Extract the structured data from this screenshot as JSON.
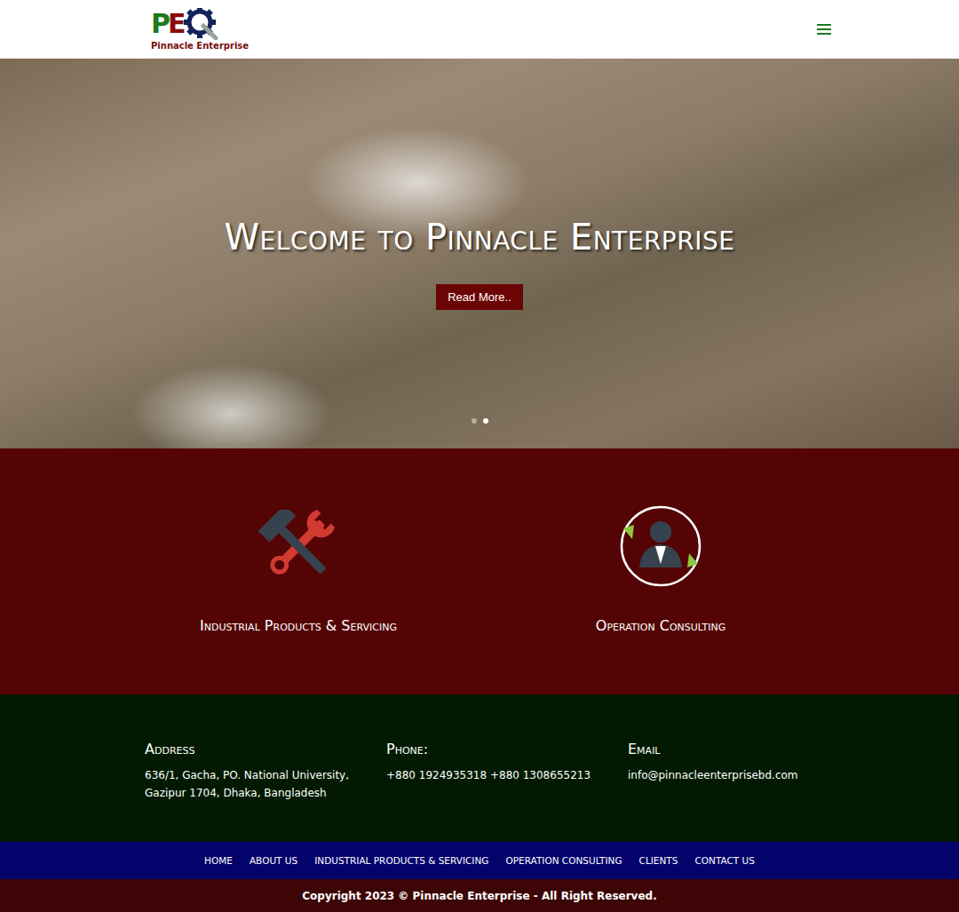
{
  "header": {
    "logo_mark": "PE",
    "logo_text": "Pinnacle Enterprise"
  },
  "hero": {
    "title": "Welcome to Pinnacle Enterprise",
    "button": "Read More..",
    "dots": [
      {
        "selected": false
      },
      {
        "selected": true
      }
    ]
  },
  "services": [
    {
      "label": "Industrial Products & Servicing",
      "kind": "tools"
    },
    {
      "label": "Operation Consulting",
      "kind": "consulting"
    }
  ],
  "contact": [
    {
      "heading": "Address",
      "text": "636/1, Gacha, PO. National University, Gazipur 1704, Dhaka, Bangladesh"
    },
    {
      "heading": "Phone:",
      "text": "+880 1924935318 +880 1308655213"
    },
    {
      "heading": "Email",
      "text": "info@pinnacleenterprisebd.com"
    }
  ],
  "nav": [
    "HOME",
    "ABOUT US",
    "INDUSTRIAL PRODUCTS & SERVICING",
    "OPERATION CONSULTING",
    "CLIENTS",
    "CONTACT US"
  ],
  "footer": {
    "copyright": "Copyright 2023 © Pinnacle Enterprise - All Right Reserved."
  }
}
